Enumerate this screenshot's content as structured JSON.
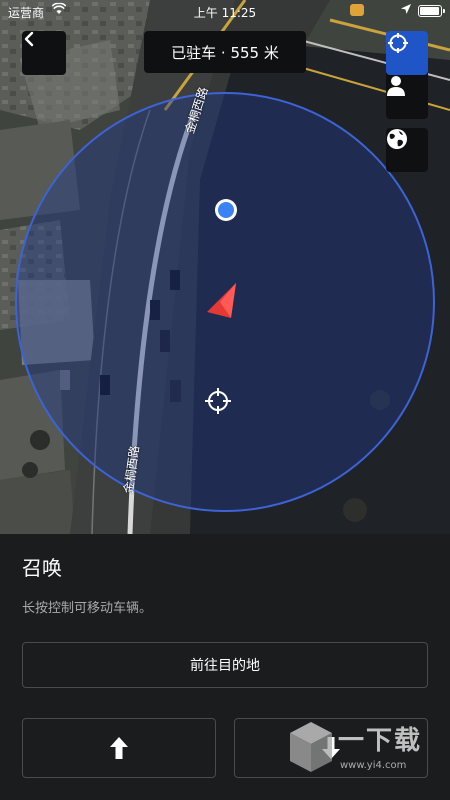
{
  "status_bar": {
    "carrier": "运营商",
    "time": "上午 11:25"
  },
  "header": {
    "title": "已驻车 · 555 米"
  },
  "map": {
    "road_label_top": "金桐西路",
    "road_label_bottom": "金桐西路",
    "overlay_color": "#1f3a8a",
    "car_marker_color": "#e53935",
    "user_dot_color": "#3b82f6"
  },
  "map_controls": {
    "recenter_icon": "crosshair-icon",
    "person_icon": "person-icon",
    "globe_icon": "globe-icon"
  },
  "panel": {
    "title": "召唤",
    "description": "长按控制可移动车辆。",
    "destination_button": "前往目的地",
    "forward_icon": "arrow-up-icon",
    "reverse_icon": "arrow-down-icon"
  },
  "watermark": {
    "text": "一下载",
    "url": "www.yi4.com"
  }
}
